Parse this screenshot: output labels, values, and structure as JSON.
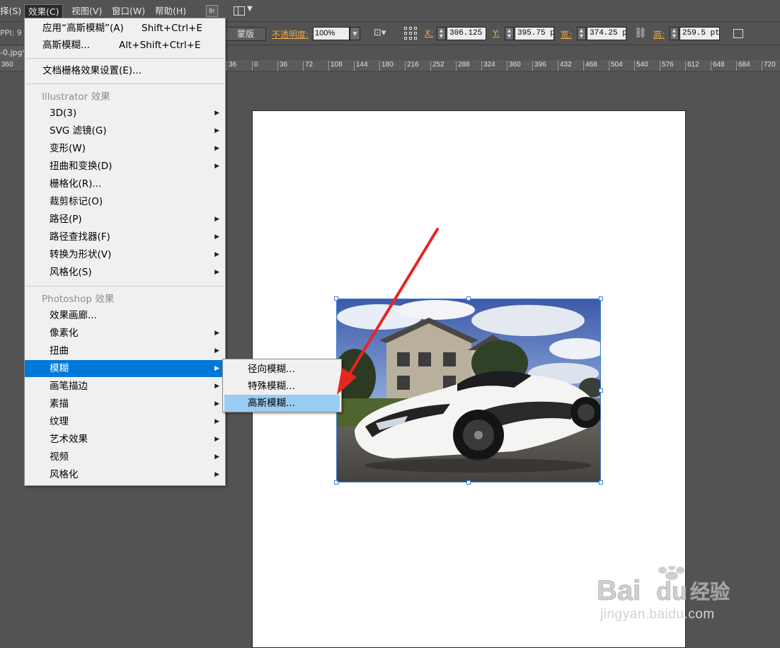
{
  "menubar": {
    "items": [
      "择(S)",
      "效果(C)",
      "视图(V)",
      "窗口(W)",
      "帮助(H)"
    ],
    "bridge_label": "Br"
  },
  "control_bar": {
    "ppi_label": "PPI: 9",
    "mask_button": "蒙版",
    "opacity_label": "不透明度:",
    "opacity_value": "100%",
    "x_label": "X:",
    "x_value": "306.125 ;",
    "y_label": "Y:",
    "y_value": "395.75 p",
    "w_label": "宽:",
    "w_value": "374.25 p",
    "h_label": "高:",
    "h_value": "259.5 pt"
  },
  "document": {
    "tab_label": "-0.jpg*"
  },
  "ruler": {
    "ticks": [
      "360",
      "36",
      "0",
      "36",
      "72",
      "108",
      "144",
      "180",
      "216",
      "252",
      "288",
      "324",
      "360",
      "396",
      "432",
      "468",
      "504",
      "540",
      "576",
      "612",
      "648",
      "684",
      "720"
    ]
  },
  "effect_menu": {
    "apply_last": {
      "label": "应用“高斯模糊”(A)",
      "shortcut": "Shift+Ctrl+E"
    },
    "last_effect": {
      "label": "高斯模糊...",
      "shortcut": "Alt+Shift+Ctrl+E"
    },
    "doc_raster": "文档栅格效果设置(E)...",
    "illustrator_header": "Illustrator 效果",
    "illustrator_items": [
      {
        "label": "3D(3)",
        "submenu": true
      },
      {
        "label": "SVG 滤镜(G)",
        "submenu": true
      },
      {
        "label": "变形(W)",
        "submenu": true
      },
      {
        "label": "扭曲和变换(D)",
        "submenu": true
      },
      {
        "label": "栅格化(R)...",
        "submenu": false
      },
      {
        "label": "裁剪标记(O)",
        "submenu": false
      },
      {
        "label": "路径(P)",
        "submenu": true
      },
      {
        "label": "路径查找器(F)",
        "submenu": true
      },
      {
        "label": "转换为形状(V)",
        "submenu": true
      },
      {
        "label": "风格化(S)",
        "submenu": true
      }
    ],
    "photoshop_header": "Photoshop 效果",
    "photoshop_items": [
      {
        "label": "效果画廊...",
        "submenu": false
      },
      {
        "label": "像素化",
        "submenu": true
      },
      {
        "label": "扭曲",
        "submenu": true
      },
      {
        "label": "模糊",
        "submenu": true,
        "highlighted": true
      },
      {
        "label": "画笔描边",
        "submenu": true
      },
      {
        "label": "素描",
        "submenu": true
      },
      {
        "label": "纹理",
        "submenu": true
      },
      {
        "label": "艺术效果",
        "submenu": true
      },
      {
        "label": "视频",
        "submenu": true
      },
      {
        "label": "风格化",
        "submenu": true
      }
    ]
  },
  "blur_submenu": {
    "items": [
      "径向模糊...",
      "特殊模糊...",
      "高斯模糊..."
    ],
    "highlighted_index": 2
  },
  "watermark": {
    "logo_text": "Bai du 经验",
    "sub_text": "jingyan.baidu.com"
  },
  "colors": {
    "highlight": "#0078d7",
    "hover": "#99ccf3",
    "annotation_arrow": "#e8251f",
    "selection": "#3f7fd8"
  }
}
